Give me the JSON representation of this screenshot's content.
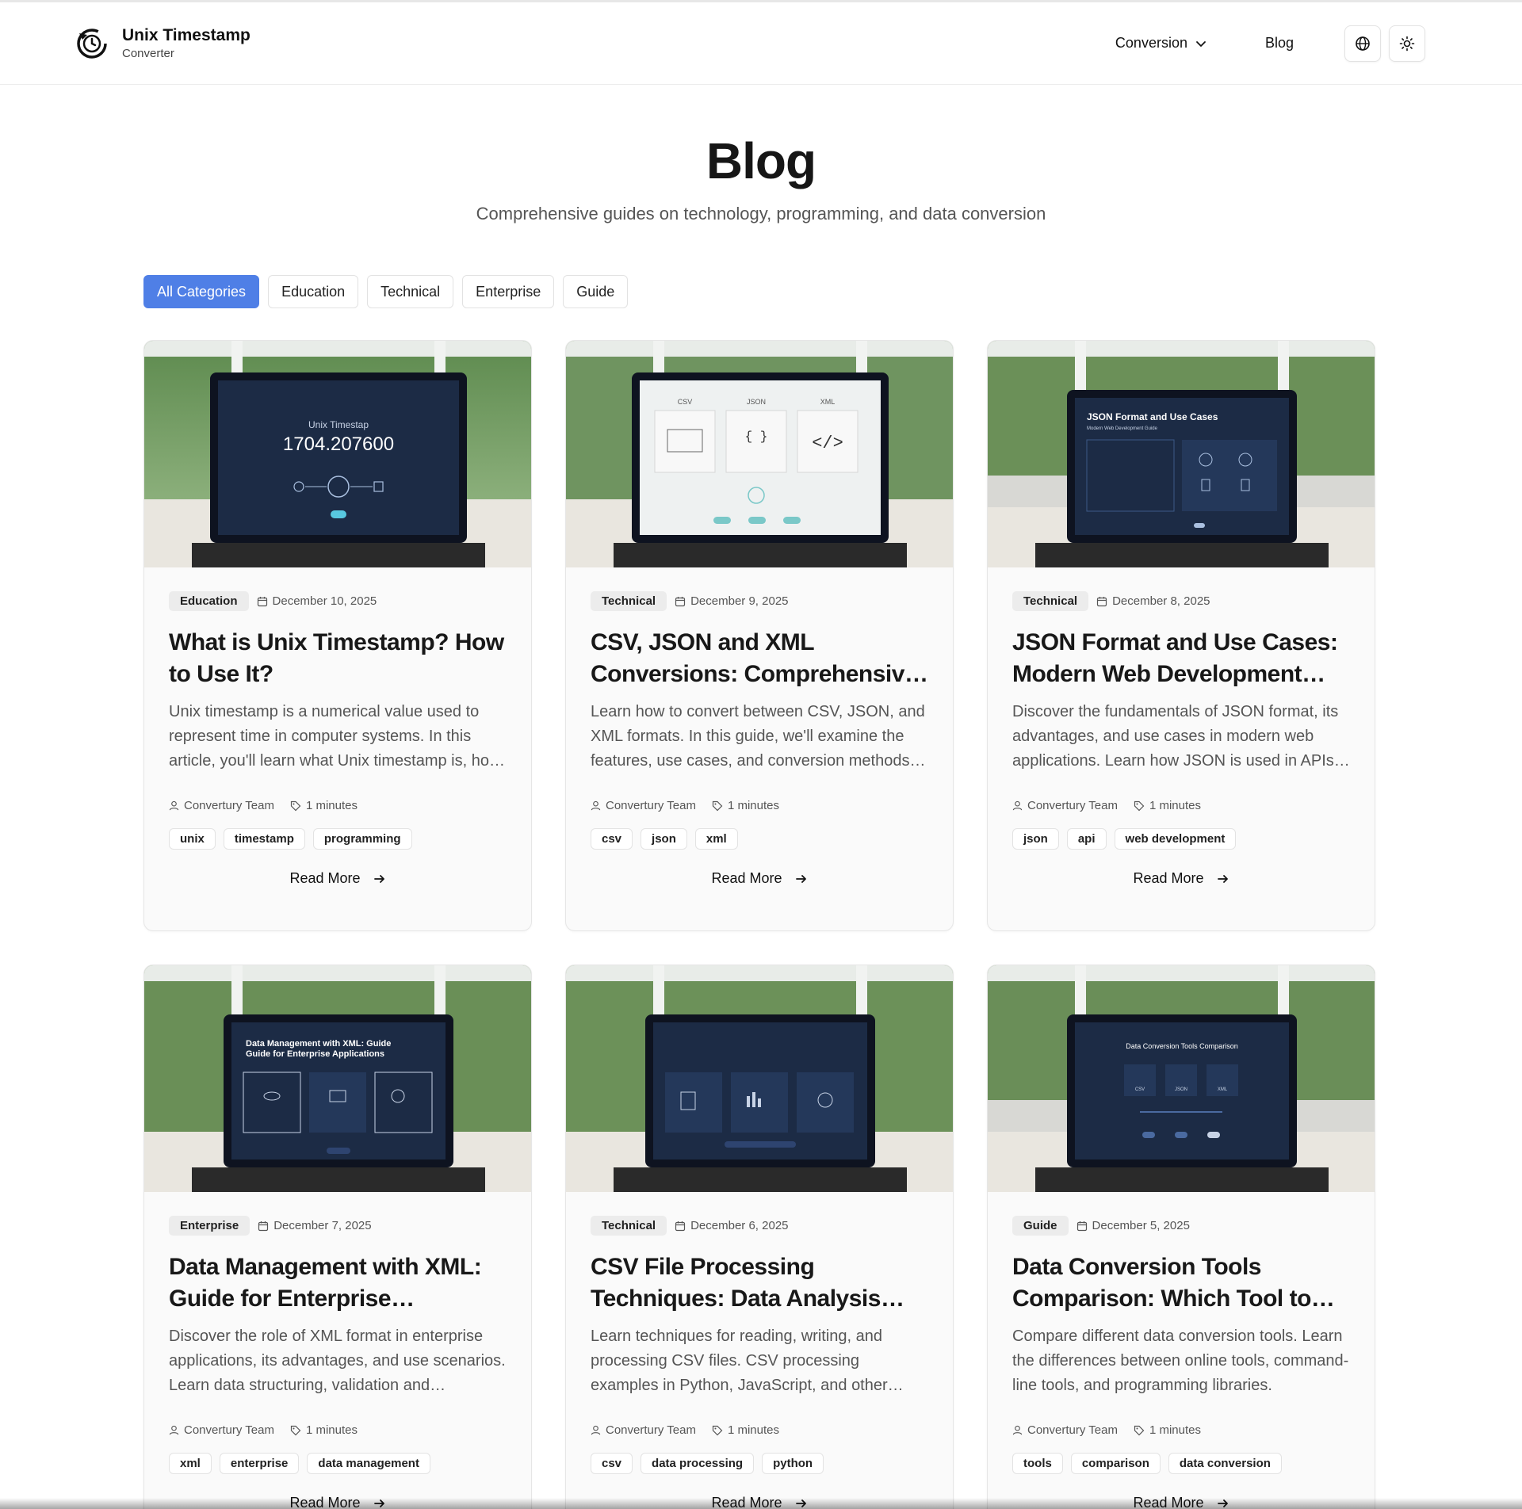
{
  "header": {
    "brand_title": "Unix Timestamp",
    "brand_subtitle": "Converter",
    "nav_conversion": "Conversion",
    "nav_blog": "Blog"
  },
  "hero": {
    "title": "Blog",
    "subtitle": "Comprehensive guides on technology, programming, and data conversion"
  },
  "filters": [
    "All Categories",
    "Education",
    "Technical",
    "Enterprise",
    "Guide"
  ],
  "posts": [
    {
      "category": "Education",
      "date": "December 10, 2025",
      "title": "What is Unix Timestamp? How to Use It?",
      "description": "Unix timestamp is a numerical value used to represent time in computer systems. In this article, you'll learn what Unix timestamp is, how it works, and how to use it.",
      "author": "Convertury Team",
      "read_time": "1 minutes",
      "tags": [
        "unix",
        "timestamp",
        "programming"
      ],
      "read_more": "Read More",
      "image": {
        "heading": "Unix Timestap",
        "value": "1704.207600"
      }
    },
    {
      "category": "Technical",
      "date": "December 9, 2025",
      "title": "CSV, JSON and XML Conversions: Comprehensive Guide",
      "description": "Learn how to convert between CSV, JSON, and XML formats. In this guide, we'll examine the features, use cases, and conversion methods of each format.",
      "author": "Convertury Team",
      "read_time": "1 minutes",
      "tags": [
        "csv",
        "json",
        "xml"
      ],
      "read_more": "Read More",
      "image": {
        "labels": [
          "CSV",
          "JSON",
          "XML"
        ]
      }
    },
    {
      "category": "Technical",
      "date": "December 8, 2025",
      "title": "JSON Format and Use Cases: Modern Web Development Guide",
      "description": "Discover the fundamentals of JSON format, its advantages, and use cases in modern web applications. Learn how JSON is used in APIs and data storage.",
      "author": "Convertury Team",
      "read_time": "1 minutes",
      "tags": [
        "json",
        "api",
        "web development"
      ],
      "read_more": "Read More",
      "image": {
        "heading": "JSON Format and Use Cases",
        "subheading": "Modern Web Development Guide"
      }
    },
    {
      "category": "Enterprise",
      "date": "December 7, 2025",
      "title": "Data Management with XML: Guide for Enterprise Applications",
      "description": "Discover the role of XML format in enterprise applications, its advantages, and use scenarios. Learn data structuring, validation and integration methods.",
      "author": "Convertury Team",
      "read_time": "1 minutes",
      "tags": [
        "xml",
        "enterprise",
        "data management"
      ],
      "read_more": "Read More",
      "image": {
        "heading": "Data Management with XML: Guide",
        "subheading": "Guide for Enterprise Applications"
      }
    },
    {
      "category": "Technical",
      "date": "December 6, 2025",
      "title": "CSV File Processing Techniques: Data Analysis Guide",
      "description": "Learn techniques for reading, writing, and processing CSV files. CSV processing examples in Python, JavaScript, and other programming languages.",
      "author": "Convertury Team",
      "read_time": "1 minutes",
      "tags": [
        "csv",
        "data processing",
        "python"
      ],
      "read_more": "Read More",
      "image": {}
    },
    {
      "category": "Guide",
      "date": "December 5, 2025",
      "title": "Data Conversion Tools Comparison: Which Tool to Use?",
      "description": "Compare different data conversion tools. Learn the differences between online tools, command-line tools, and programming libraries.",
      "author": "Convertury Team",
      "read_time": "1 minutes",
      "tags": [
        "tools",
        "comparison",
        "data conversion"
      ],
      "read_more": "Read More",
      "image": {
        "heading": "Data Conversion Tools Comparison",
        "labels": [
          "CSV",
          "JSON",
          "XML"
        ]
      }
    }
  ],
  "colors": {
    "accent": "#4f7fe6",
    "screen_dark": "#1c2b45",
    "screen_light": "#eef1f1"
  }
}
